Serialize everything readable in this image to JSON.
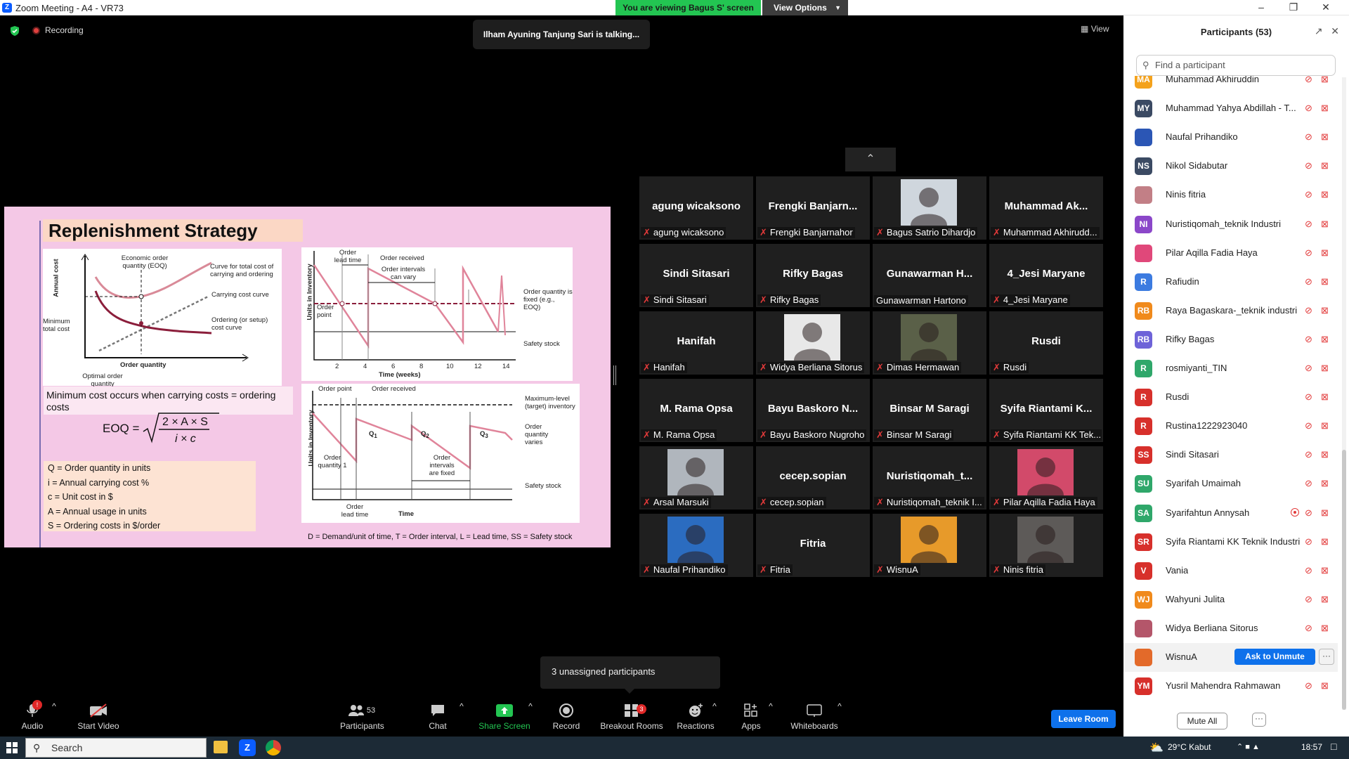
{
  "window": {
    "title": "Zoom Meeting - A4 - VR73",
    "viewing_banner": "You are viewing Bagus S' screen",
    "view_options": "View Options"
  },
  "meeting": {
    "recording": "Recording",
    "talking": "Ilham Ayuning Tanjung Sari is talking...",
    "view_label": "View",
    "unassigned": "3 unassigned participants"
  },
  "slide": {
    "title": "Replenishment Strategy",
    "graph1": {
      "ylabel": "Annual cost",
      "xlabel": "Order quantity",
      "eoq": "Economic order quantity (EOQ)",
      "total_curve": "Curve for total cost of carrying and ordering",
      "carrying": "Carrying cost curve",
      "ordering": "Ordering (or setup) cost curve",
      "min_total": "Minimum total cost",
      "optimal": "Optimal order quantity"
    },
    "graph2": {
      "ylabel": "Units in Inventory",
      "xlabel": "Time (weeks)",
      "ticks": [
        "2",
        "4",
        "6",
        "8",
        "10",
        "12",
        "14"
      ],
      "lead_time": "Order lead time",
      "received": "Order received",
      "intervals": "Order intervals can vary",
      "order_point": "Order point",
      "fixed": "Order quantity is fixed (e.g., EOQ)",
      "safety": "Safety stock"
    },
    "graph3": {
      "ylabel": "Units in Inventory",
      "xlabel": "Time",
      "order_point": "Order point",
      "received": "Order received",
      "max_level": "Maximum-level (target) inventory",
      "varies": "Order quantity varies",
      "q1": "Q",
      "q2": "Q",
      "q3": "Q",
      "s1": "1",
      "s2": "2",
      "s3": "3",
      "oq1": "Order quantity 1",
      "intervals_fixed": "Order intervals are fixed",
      "lead": "Order lead time",
      "safety": "Safety stock"
    },
    "min_cost": "Minimum cost occurs when  carrying costs = ordering costs",
    "eoq_label": "EOQ =",
    "eoq_num": "2 × A × S",
    "eoq_den": "i × c",
    "legend": [
      "Q = Order quantity in units",
      "i = Annual carrying cost %",
      "c = Unit cost in $",
      "A = Annual usage in units",
      "S = Ordering costs in $/order"
    ],
    "caption": "D = Demand/unit of time, T = Order interval, L = Lead time, SS = Safety stock"
  },
  "tiles": [
    {
      "name": "agung wicaksono",
      "label": "agung wicaksono"
    },
    {
      "name": "Frengki  Banjarn...",
      "label": "Frengki Banjarnahor"
    },
    {
      "name": "",
      "label": "Bagus Satrio Dihardjo"
    },
    {
      "name": "Muhammad  Ak...",
      "label": "Muhammad Akhirudd..."
    },
    {
      "name": "Sindi Sitasari",
      "label": "Sindi Sitasari"
    },
    {
      "name": "Rifky Bagas",
      "label": "Rifky Bagas"
    },
    {
      "name": "Gunawarman  H...",
      "label": "Gunawarman Hartono"
    },
    {
      "name": "4_Jesi Maryane",
      "label": "4_Jesi Maryane"
    },
    {
      "name": "Hanifah",
      "label": "Hanifah"
    },
    {
      "name": "",
      "label": "Widya Berliana Sitorus"
    },
    {
      "name": "",
      "label": "Dimas Hermawan"
    },
    {
      "name": "Rusdi",
      "label": "Rusdi"
    },
    {
      "name": "M. Rama Opsa",
      "label": "M. Rama Opsa"
    },
    {
      "name": "Bayu Baskoro  N...",
      "label": "Bayu Baskoro Nugroho"
    },
    {
      "name": "Binsar M Saragi",
      "label": "Binsar M Saragi"
    },
    {
      "name": "Syifa Riantami  K...",
      "label": "Syifa Riantami KK Tek..."
    },
    {
      "name": "",
      "label": "Arsal Marsuki"
    },
    {
      "name": "cecep.sopian",
      "label": "cecep.sopian"
    },
    {
      "name": "Nuristiqomah_t...",
      "label": "Nuristiqomah_teknik I..."
    },
    {
      "name": "",
      "label": "Pilar Aqilla Fadia Haya"
    },
    {
      "name": "",
      "label": "Naufal Prihandiko"
    },
    {
      "name": "Fitria",
      "label": "Fitria"
    },
    {
      "name": "",
      "label": "WisnuA"
    },
    {
      "name": "",
      "label": "Ninis fitria"
    }
  ],
  "toolbar": {
    "audio": "Audio",
    "video": "Start Video",
    "participants": "Participants",
    "participants_count": "53",
    "chat": "Chat",
    "share": "Share Screen",
    "record": "Record",
    "breakout": "Breakout Rooms",
    "breakout_badge": "3",
    "reactions": "Reactions",
    "apps": "Apps",
    "whiteboards": "Whiteboards",
    "audio_badge": "!",
    "leave": "Leave Room"
  },
  "panel": {
    "title": "Participants (53)",
    "search_placeholder": "Find a participant",
    "mute_all": "Mute All",
    "ask_unmute": "Ask to Unmute",
    "more": "···",
    "participants": [
      {
        "initials": "MA",
        "name": "Muhammad Akhiruddin",
        "color": "#f4a21c"
      },
      {
        "initials": "MY",
        "name": "Muhammad Yahya Abdillah - T...",
        "color": "#3b4a63"
      },
      {
        "initials": "",
        "name": "Naufal Prihandiko",
        "color": "#2b56b5"
      },
      {
        "initials": "NS",
        "name": "Nikol Sidabutar",
        "color": "#3b4a63"
      },
      {
        "initials": "",
        "name": "Ninis fitria",
        "color": "#c27f86"
      },
      {
        "initials": "NI",
        "name": "Nuristiqomah_teknik Industri",
        "color": "#8b47c9"
      },
      {
        "initials": "",
        "name": "Pilar Aqilla Fadia Haya",
        "color": "#e0487a"
      },
      {
        "initials": "R",
        "name": "Rafiudin",
        "color": "#3c7be0"
      },
      {
        "initials": "RB",
        "name": "Raya Bagaskara-_teknik industri",
        "color": "#f08a1c"
      },
      {
        "initials": "RB",
        "name": "Rifky Bagas",
        "color": "#6e63d8"
      },
      {
        "initials": "R",
        "name": "rosmiyanti_TIN",
        "color": "#2fa76a"
      },
      {
        "initials": "R",
        "name": "Rusdi",
        "color": "#d7302b"
      },
      {
        "initials": "R",
        "name": "Rustina1222923040",
        "color": "#d7302b"
      },
      {
        "initials": "SS",
        "name": "Sindi Sitasari",
        "color": "#d7302b"
      },
      {
        "initials": "SU",
        "name": "Syarifah Umaimah",
        "color": "#2fa76a"
      },
      {
        "initials": "SA",
        "name": "Syarifahtun Annysah",
        "color": "#2fa76a"
      },
      {
        "initials": "SR",
        "name": "Syifa Riantami KK Teknik Industri",
        "color": "#d7302b"
      },
      {
        "initials": "V",
        "name": "Vania",
        "color": "#d7302b"
      },
      {
        "initials": "WJ",
        "name": "Wahyuni Julita",
        "color": "#f08a1c"
      },
      {
        "initials": "",
        "name": "Widya Berliana Sitorus",
        "color": "#b4566a"
      },
      {
        "initials": "",
        "name": "WisnuA",
        "color": "#e36a2a"
      },
      {
        "initials": "YM",
        "name": "Yusril Mahendra Rahmawan",
        "color": "#d7302b"
      }
    ]
  },
  "taskbar": {
    "search": "Search",
    "weather": "29°C  Kabut",
    "time": "18:57"
  }
}
